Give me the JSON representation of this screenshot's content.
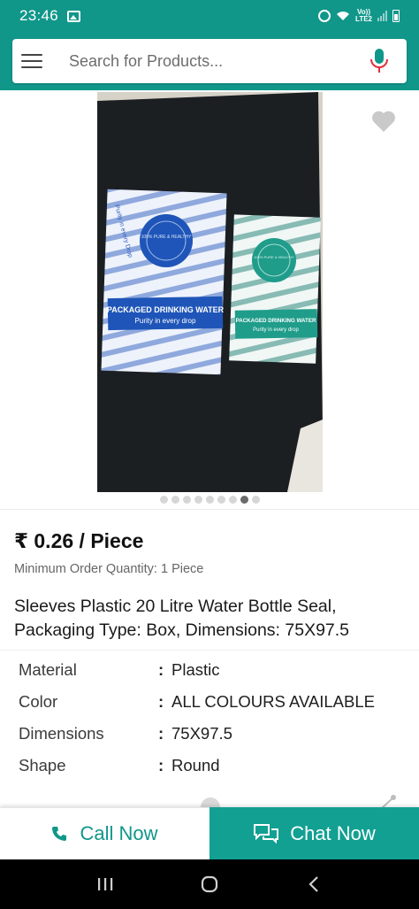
{
  "status_bar": {
    "time": "23:46",
    "network_label_top": "Vo))",
    "network_label_bottom": "LTE2",
    "icons": [
      "gallery-icon",
      "alarm-icon",
      "wifi-icon",
      "signal-icon",
      "battery-icon"
    ]
  },
  "header": {
    "search_placeholder": "Search for Products...",
    "icons": [
      "menu-icon",
      "mic-icon"
    ]
  },
  "gallery": {
    "image_count": 9,
    "active_index": 7,
    "image_text": {
      "label_main": "PACKAGED DRINKING WATER",
      "label_sub": "Purity in every drop",
      "seal_text": "100% PURE & HEALTHY",
      "pattern_text": "Purity in every Drop"
    }
  },
  "product": {
    "price": "₹ 0.26 / Piece",
    "moq": "Minimum Order Quantity: 1 Piece",
    "title": "Sleeves Plastic 20 Litre Water Bottle Seal, Packaging Type: Box, Dimensions: 75X97.5",
    "specs": [
      {
        "key": "Material",
        "sep": ":",
        "value": "Plastic"
      },
      {
        "key": "Color",
        "sep": ":",
        "value": "ALL COLOURS AVAILABLE"
      },
      {
        "key": "Dimensions",
        "sep": ":",
        "value": "75X97.5"
      },
      {
        "key": "Shape",
        "sep": ":",
        "value": "Round"
      }
    ]
  },
  "cta": {
    "call_label": "Call Now",
    "chat_label": "Chat Now"
  },
  "colors": {
    "brand": "#10978a",
    "chat_bg": "#12a092",
    "text_dark": "#1a1a1a"
  }
}
